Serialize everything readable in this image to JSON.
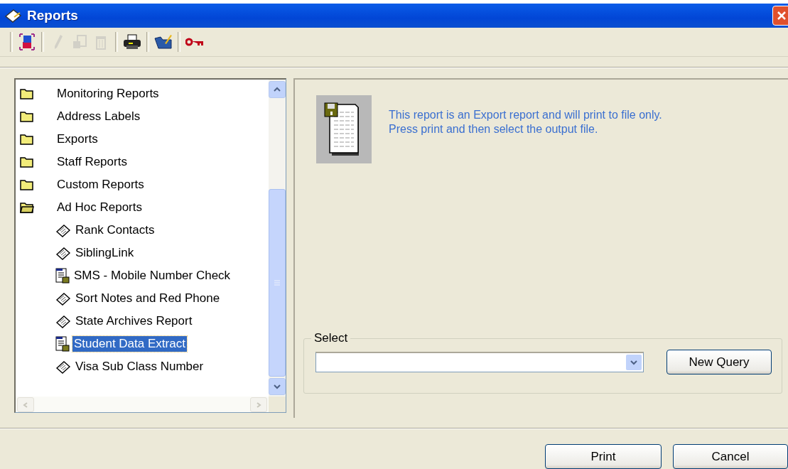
{
  "window": {
    "title": "Reports"
  },
  "toolbar": [
    {
      "kind": "cubes",
      "disabled": false
    },
    {
      "kind": "pencil",
      "disabled": true
    },
    {
      "kind": "copy",
      "disabled": true
    },
    {
      "kind": "trash",
      "disabled": true
    },
    {
      "kind": "printer",
      "disabled": false
    },
    {
      "kind": "folder-edit",
      "disabled": false
    },
    {
      "kind": "key",
      "disabled": false
    }
  ],
  "tree": [
    {
      "label": "Monitoring Reports",
      "expanded": false
    },
    {
      "label": "Address Labels",
      "expanded": false
    },
    {
      "label": "Exports",
      "expanded": false
    },
    {
      "label": "Staff Reports",
      "expanded": false
    },
    {
      "label": "Custom Reports",
      "expanded": false
    },
    {
      "label": "Ad Hoc Reports",
      "expanded": true,
      "children": [
        {
          "label": "Rank Contacts",
          "kind": "notepad",
          "selected": false
        },
        {
          "label": "SiblingLink",
          "kind": "notepad",
          "selected": false
        },
        {
          "label": "SMS - Mobile Number Check",
          "kind": "export",
          "selected": false
        },
        {
          "label": "Sort Notes and Red Phone",
          "kind": "notepad",
          "selected": false
        },
        {
          "label": "State Archives Report",
          "kind": "notepad",
          "selected": false
        },
        {
          "label": "Student Data Extract",
          "kind": "export",
          "selected": true
        },
        {
          "label": "Visa Sub Class Number",
          "kind": "notepad",
          "selected": false
        }
      ]
    }
  ],
  "info": {
    "lines": [
      "This report is an Export report and will print to file only.",
      "Press print and then select the output file."
    ]
  },
  "select_group": {
    "label": "Select",
    "button": "New Query"
  },
  "buttons": [
    "Print",
    "Cancel"
  ]
}
